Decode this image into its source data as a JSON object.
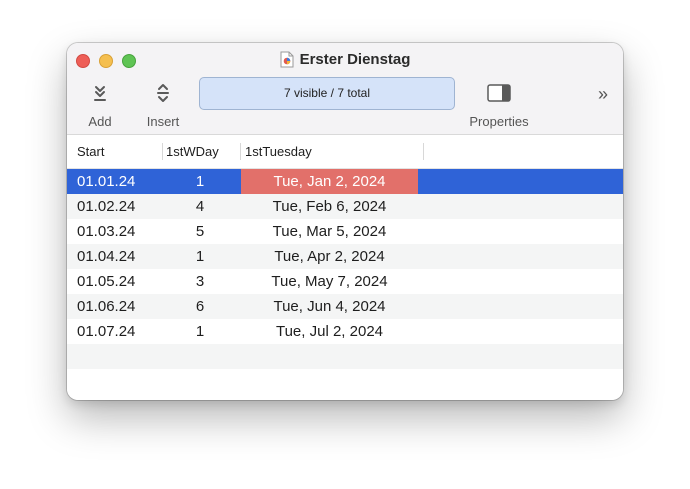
{
  "window": {
    "title": "Erster Dienstag"
  },
  "toolbar": {
    "add_label": "Add",
    "insert_label": "Insert",
    "status": "7 visible / 7 total",
    "properties_label": "Properties",
    "overflow_glyph": "»"
  },
  "table": {
    "headers": [
      "Start",
      "1stWDay",
      "1stTuesday"
    ],
    "rows": [
      {
        "start": "01.01.24",
        "wday": "1",
        "tuesday": "Tue, Jan 2, 2024",
        "selected": true
      },
      {
        "start": "01.02.24",
        "wday": "4",
        "tuesday": "Tue, Feb 6, 2024"
      },
      {
        "start": "01.03.24",
        "wday": "5",
        "tuesday": "Tue, Mar 5, 2024"
      },
      {
        "start": "01.04.24",
        "wday": "1",
        "tuesday": "Tue, Apr 2, 2024"
      },
      {
        "start": "01.05.24",
        "wday": "3",
        "tuesday": "Tue, May 7, 2024"
      },
      {
        "start": "01.06.24",
        "wday": "6",
        "tuesday": "Tue, Jun 4, 2024"
      },
      {
        "start": "01.07.24",
        "wday": "1",
        "tuesday": "Tue, Jul 2, 2024"
      }
    ]
  },
  "colors": {
    "selection": "#2f63d7",
    "highlight_cell": "#e2706a",
    "status_field": "#d5e3f9"
  }
}
